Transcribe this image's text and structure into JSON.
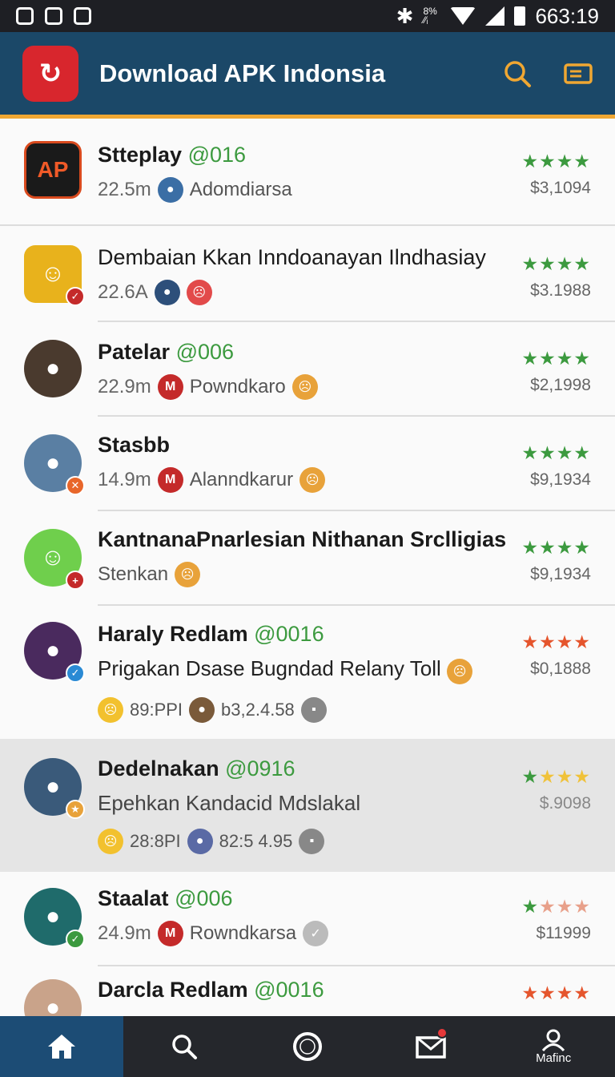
{
  "status_bar": {
    "time": "663:19",
    "network": "8% ⁄⁄ᵢ"
  },
  "app_bar": {
    "logo_text": "↻",
    "title": "Download APK Indonsia"
  },
  "colors": {
    "app_bar": "#1b4868",
    "accent": "#f0a732",
    "green": "#3c9a3f",
    "red_star": "#e5552d"
  },
  "list": [
    {
      "title": "Stteplay",
      "tag": "@016",
      "size": "22.5m",
      "author": "Adomdiarsa",
      "stars": "★★★★",
      "price": "$3,1094"
    },
    {
      "title": "Dembaian Kkan Inndoanayan Ilndhasiay",
      "size": "22.6A",
      "stars": "★★★★",
      "price": "$3.1988"
    },
    {
      "title": "Patelar",
      "tag": "@006",
      "size": "22.9m",
      "author": "Powndkaro",
      "stars": "★★★★",
      "price": "$2,1998"
    },
    {
      "title": "Stasbb",
      "size": "14.9m",
      "author": "Alanndkarur",
      "stars": "★★★★",
      "price": "$9,1934"
    },
    {
      "title": "KantnanaPnarlesian Nithanan Srclligias",
      "author": "Stenkan",
      "stars": "★★★★",
      "price": "$9,1934"
    },
    {
      "title": "Haraly Redlam",
      "tag": "@0016",
      "desc": "Prigakan Dsase Bugndad Relany Toll",
      "meta1": "89:PPI",
      "meta2": "b3,2.4.58",
      "stars": "★★★★",
      "price": "$0,1888"
    },
    {
      "title": "Dedelnakan",
      "tag": "@0916",
      "desc": "Epehkan Kandacid Mdslakal",
      "meta1": "28:8PI",
      "meta2": "82:5 4.95",
      "stars": "★★★★",
      "price": "$.9098"
    },
    {
      "title": "Staalat",
      "tag": "@006",
      "size": "24.9m",
      "author": "Rowndkarsa",
      "stars": "★★★★",
      "price": "$11999"
    },
    {
      "title": "Darcla Redlam",
      "tag": "@0016",
      "stars": "★★★★"
    }
  ],
  "bottom_nav": {
    "profile_label": "Mafinc",
    "notif_count": "0"
  }
}
